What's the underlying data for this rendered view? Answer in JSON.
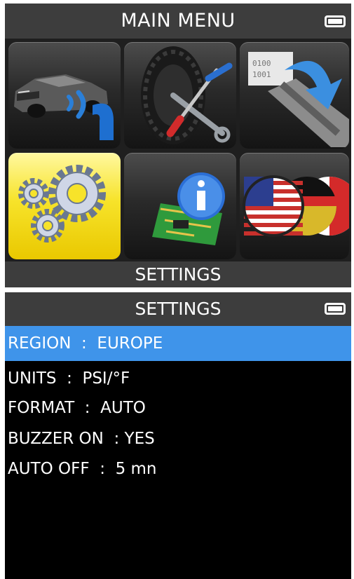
{
  "main_menu": {
    "title": "MAIN MENU",
    "tiles": [
      {
        "icon": "car-sensor-icon"
      },
      {
        "icon": "tire-tools-icon"
      },
      {
        "icon": "data-transfer-icon"
      },
      {
        "icon": "gears-icon",
        "selected": true
      },
      {
        "icon": "info-board-icon"
      },
      {
        "icon": "language-flags-icon"
      }
    ],
    "caption": "SETTINGS",
    "selected_color": "#f7e32a"
  },
  "settings": {
    "title": "SETTINGS",
    "highlight_color": "#3f94ea",
    "items": [
      {
        "text": "REGION  :  EUROPE",
        "selected": true
      },
      {
        "text": "UNITS  :  PSI/°F"
      },
      {
        "text": "FORMAT  :  AUTO"
      },
      {
        "text": "BUZZER ON  : YES"
      },
      {
        "text": "AUTO OFF  :  5 mn"
      }
    ]
  }
}
